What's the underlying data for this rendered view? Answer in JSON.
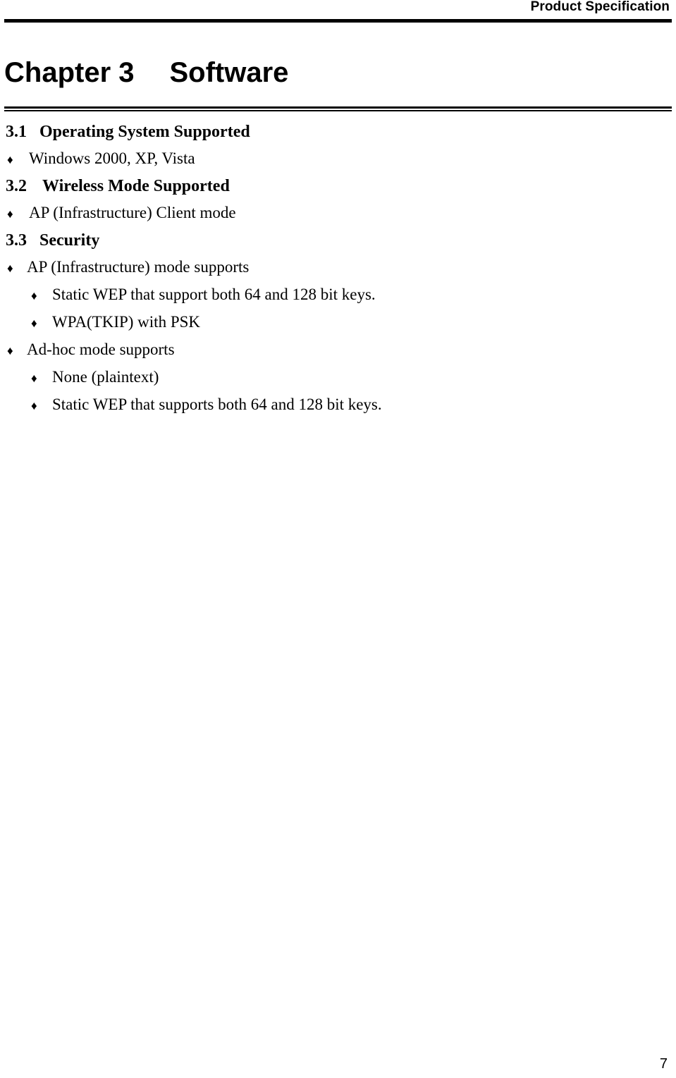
{
  "header": {
    "title": "Product Specification"
  },
  "chapter": {
    "label": "Chapter 3",
    "name": "Software"
  },
  "sections": [
    {
      "number": "3.1",
      "title": "Operating System Supported",
      "bullets": [
        {
          "glyph": "♦",
          "text": "Windows 2000, XP, Vista",
          "level": 1
        }
      ]
    },
    {
      "number": "3.2",
      "title": "Wireless Mode Supported",
      "bullets": [
        {
          "glyph": "♦",
          "text": "AP (Infrastructure) Client mode",
          "level": 1
        }
      ]
    },
    {
      "number": "3.3",
      "title": "Security",
      "bullets": [
        {
          "glyph": "♦",
          "text": "AP (Infrastructure) mode supports",
          "level": 1
        },
        {
          "glyph": "♦",
          "text": "Static WEP that support both 64 and 128 bit keys.",
          "level": 2
        },
        {
          "glyph": "♦",
          "text": "WPA(TKIP) with PSK",
          "level": 2
        },
        {
          "glyph": "♦",
          "text": "Ad-hoc mode supports",
          "level": 1
        },
        {
          "glyph": "♦",
          "text": "None (plaintext)",
          "level": 2
        },
        {
          "glyph": "♦",
          "text": "Static WEP that supports both 64 and 128 bit keys.",
          "level": 2
        }
      ]
    }
  ],
  "footer": {
    "page_number": "7"
  }
}
